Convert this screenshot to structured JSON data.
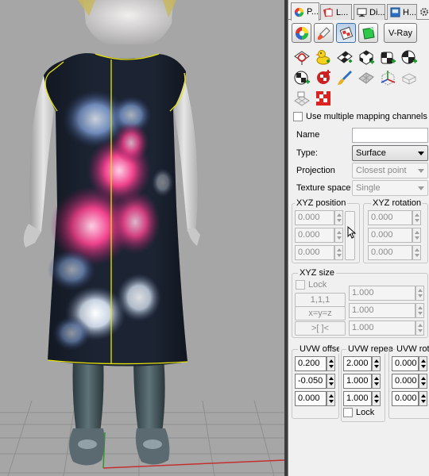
{
  "panel": {
    "tabs": [
      {
        "label": "P...",
        "icon": "color-wheel-icon"
      },
      {
        "label": "L...",
        "icon": "layers-icon"
      },
      {
        "label": "Di...",
        "icon": "display-icon"
      },
      {
        "label": "H...",
        "icon": "help-icon"
      }
    ],
    "toolbar": {
      "buttons": [
        "material-ball-icon",
        "paint-brush-icon",
        "texture-mapping-icon",
        "decal-icon"
      ],
      "vray_label": "V-Ray"
    },
    "mapping_icons": [
      "apply-planar-mapping-icon",
      "rubber-duck-icon",
      "checker-mapping-icon",
      "checker-box-icon",
      "checker-cube-icon",
      "checker-sphere-icon",
      "checker-cylinder-icon",
      "red-checker-icon",
      "paint-brush-icon",
      "gray-mesh-icon",
      "axis-box-icon",
      "wire-box-icon",
      "planar-grid-icon",
      "red-checker-tile-icon"
    ],
    "use_multiple_channels_label": "Use multiple mapping channels",
    "name_label": "Name",
    "name_value": "",
    "type_label": "Type:",
    "type_value": "Surface",
    "projection_label": "Projection",
    "projection_value": "Closest point",
    "texture_space_label": "Texture space",
    "texture_space_value": "Single",
    "xyz_position": {
      "title": "XYZ position",
      "values": [
        "0.000",
        "0.000",
        "0.000"
      ]
    },
    "xyz_rotation": {
      "title": "XYZ rotation",
      "values": [
        "0.000",
        "0.000",
        "0.000"
      ]
    },
    "xyz_size": {
      "title": "XYZ size",
      "lock_label": "Lock",
      "buttons": [
        "1,1,1",
        "x=y=z",
        ">[ ]<"
      ],
      "values": [
        "1.000",
        "1.000",
        "1.000"
      ]
    },
    "uvw_offset": {
      "title": "UVW offset",
      "values": [
        "0.200",
        "-0.050",
        "0.000"
      ]
    },
    "uvw_repeat": {
      "title": "UVW repeat",
      "values": [
        "2.000",
        "1.000",
        "1.000"
      ],
      "lock_label": "Lock"
    },
    "uvw_rotation": {
      "title": "UVW rotation",
      "values": [
        "0.000",
        "0.000",
        "0.000"
      ]
    }
  },
  "colors": {
    "viewport_bg": "#a6a6a6",
    "dress_base": "#1c2433",
    "flower_pink": "#e4327a",
    "selection_yellow": "#e6e20c",
    "panel_bg": "#f0f0f0"
  }
}
